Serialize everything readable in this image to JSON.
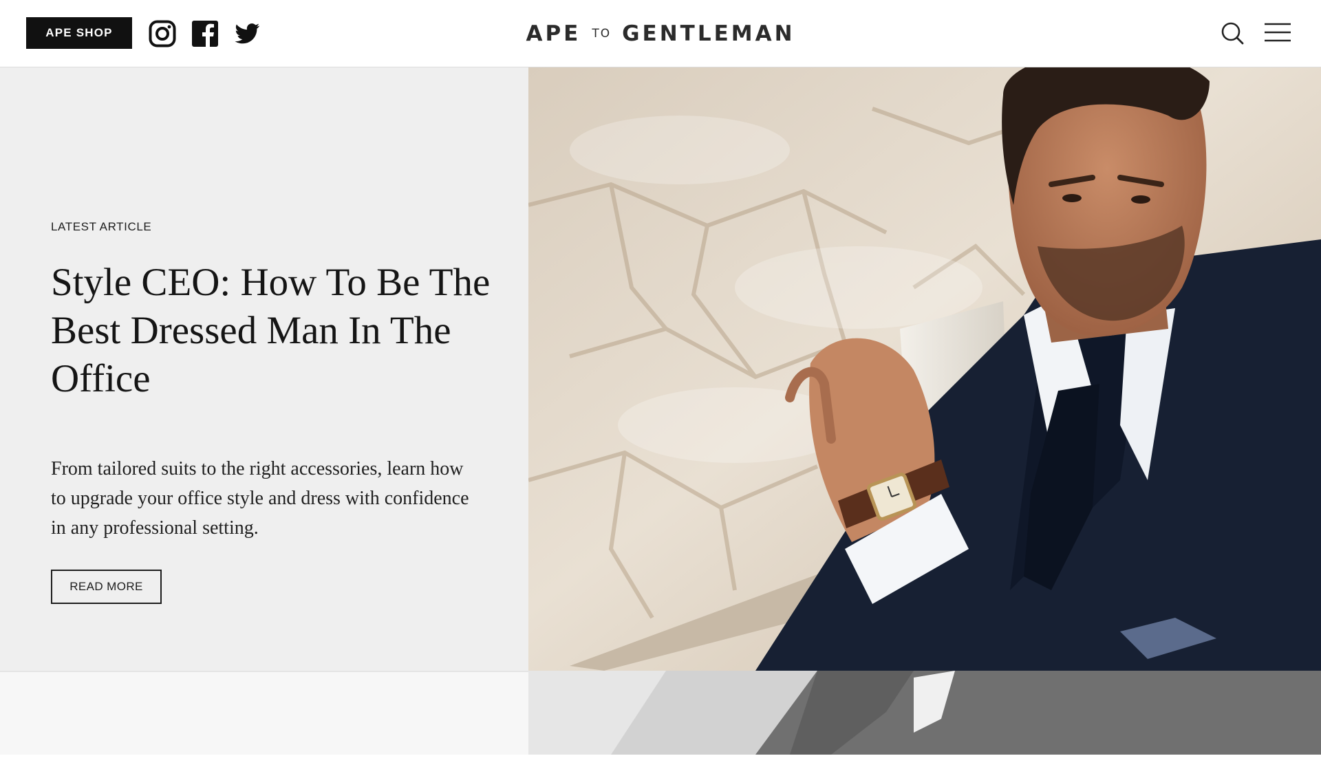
{
  "header": {
    "shop_label": "APE SHOP",
    "social": [
      {
        "name": "instagram-icon"
      },
      {
        "name": "facebook-icon"
      },
      {
        "name": "twitter-icon"
      }
    ],
    "logo": {
      "left": "APE",
      "middle": "TO",
      "right": "GENTLEMAN"
    },
    "search_icon": "search-icon",
    "menu_icon": "hamburger-menu-icon"
  },
  "hero": {
    "eyebrow": "LATEST ARTICLE",
    "title": "Style CEO: How To Be The Best Dressed Man In The Office",
    "excerpt": "From tailored suits to the right accessories, learn how to upgrade your office style and dress with confidence in any professional setting.",
    "cta_label": "READ MORE"
  },
  "colors": {
    "accent": "#111111",
    "panel_bg": "#efefef",
    "text": "#1c1c1c"
  }
}
